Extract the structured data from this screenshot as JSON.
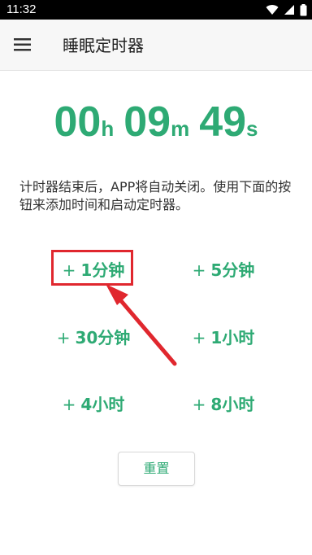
{
  "status_bar": {
    "time": "11:32",
    "icons": [
      "wifi-icon",
      "cell-signal-icon",
      "battery-icon"
    ]
  },
  "app_bar": {
    "menu_icon": "hamburger-menu-icon",
    "title": "睡眠定时器"
  },
  "countdown": {
    "hours": "00",
    "hours_unit": "h",
    "minutes": "09",
    "minutes_unit": "m",
    "seconds": "49",
    "seconds_unit": "s"
  },
  "description": "计时器结束后，APP将自动关闭。使用下面的按钮来添加时间和启动定时器。",
  "buttons": [
    {
      "plus": "+",
      "label": "1分钟"
    },
    {
      "plus": "+",
      "label": "5分钟"
    },
    {
      "plus": "+",
      "label": "30分钟"
    },
    {
      "plus": "+",
      "label": "1小时"
    },
    {
      "plus": "+",
      "label": "4小时"
    },
    {
      "plus": "+",
      "label": "8小时"
    }
  ],
  "reset_label": "重置",
  "colors": {
    "accent": "#2eaa74",
    "annotation": "#e0272e",
    "status_bar": "#000000",
    "app_bar": "#f7f7f7"
  }
}
